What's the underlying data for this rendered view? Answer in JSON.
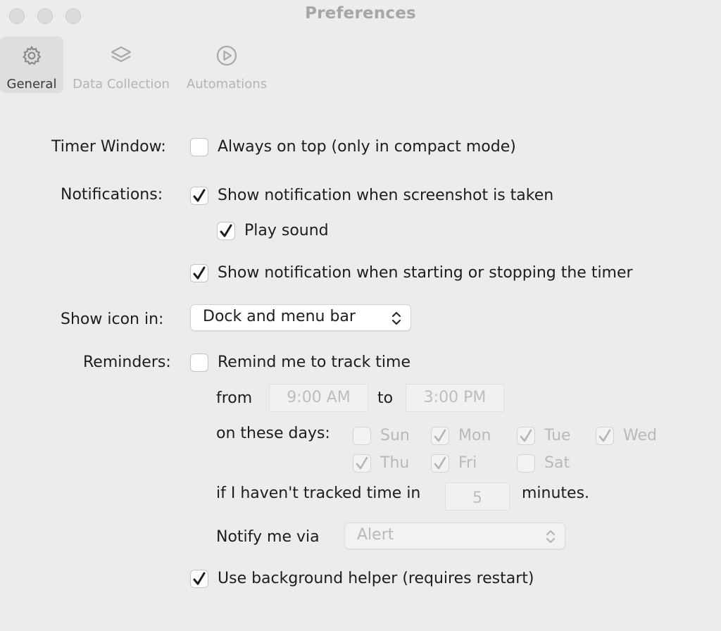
{
  "window": {
    "title": "Preferences"
  },
  "toolbar": {
    "items": [
      {
        "label": "General",
        "icon": "gear-icon",
        "active": true
      },
      {
        "label": "Data Collection",
        "icon": "layers-icon",
        "active": false
      },
      {
        "label": "Automations",
        "icon": "play-circle-icon",
        "active": false
      }
    ]
  },
  "timer_window": {
    "label": "Timer Window:",
    "always_on_top": {
      "label": "Always on top (only in compact mode)",
      "checked": false
    }
  },
  "notifications": {
    "label": "Notifications:",
    "screenshot": {
      "label": "Show notification when screenshot is taken",
      "checked": true
    },
    "play_sound": {
      "label": "Play sound",
      "checked": true
    },
    "timer": {
      "label": "Show notification when starting or stopping the timer",
      "checked": true
    }
  },
  "show_icon": {
    "label": "Show icon in:",
    "value": "Dock and menu bar"
  },
  "reminders": {
    "label": "Reminders:",
    "remind": {
      "label": "Remind me to track time",
      "checked": false
    },
    "from_label": "from",
    "from_value": "9:00 AM",
    "to_label": "to",
    "to_value": "3:00 PM",
    "days_label": "on these days:",
    "days": [
      {
        "label": "Sun",
        "checked": false
      },
      {
        "label": "Mon",
        "checked": true
      },
      {
        "label": "Tue",
        "checked": true
      },
      {
        "label": "Wed",
        "checked": true
      },
      {
        "label": "Thu",
        "checked": true
      },
      {
        "label": "Fri",
        "checked": true
      },
      {
        "label": "Sat",
        "checked": false
      }
    ],
    "idle_prefix": "if I haven't tracked time in",
    "idle_value": "5",
    "idle_suffix": "minutes.",
    "notify_label": "Notify me via",
    "notify_value": "Alert"
  },
  "background_helper": {
    "label": "Use background helper (requires restart)",
    "checked": true
  },
  "colors": {
    "background": "#ececec",
    "text": "#1d1d1d",
    "disabled_text": "#b9b9b9",
    "title": "#a6a6a6"
  }
}
